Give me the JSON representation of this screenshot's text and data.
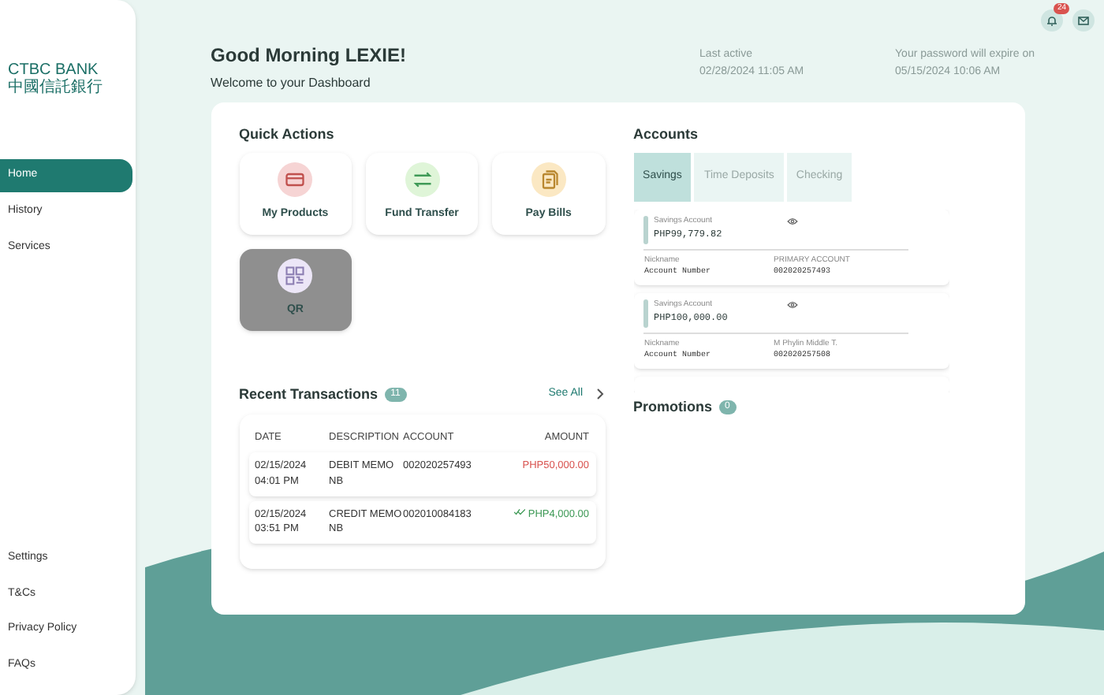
{
  "header": {
    "greeting": "Good Morning LEXIE!",
    "subtitle": "Welcome to your Dashboard",
    "last_active_label": "Last active",
    "last_active": "02/28/2024 11:05 AM",
    "password_label": "Your password will expire on",
    "password_expiry": "05/15/2024 10:06 AM",
    "notification_count": "24"
  },
  "logo": {
    "name": "CTBC BANK",
    "subname": "中國信託銀行"
  },
  "sidebar": {
    "items": [
      {
        "label": "Home",
        "selected": true
      },
      {
        "label": "History",
        "selected": false
      },
      {
        "label": "Services",
        "selected": false
      }
    ],
    "footer_items": [
      {
        "label": "Settings"
      },
      {
        "label": "T&Cs"
      },
      {
        "label": "Privacy Policy"
      },
      {
        "label": "FAQs"
      }
    ]
  },
  "quick_actions": {
    "title": "Quick Actions",
    "items": [
      {
        "label": "My Products",
        "kind": "card",
        "color": "#f6d4d4",
        "selected": false
      },
      {
        "label": "Fund Transfer",
        "kind": "transfer",
        "color": "#dff5d8",
        "selected": false
      },
      {
        "label": "Pay Bills",
        "kind": "bills",
        "color": "#fbe8c3",
        "selected": false
      },
      {
        "label": "QR",
        "kind": "qr",
        "color": "#ece6f7",
        "selected": true
      }
    ]
  },
  "accounts": {
    "title": "Accounts",
    "tabs": [
      {
        "label": "Savings",
        "selected": true
      },
      {
        "label": "Time Deposits",
        "selected": false
      },
      {
        "label": "Checking",
        "selected": false
      }
    ],
    "items": [
      {
        "type": "Savings Account",
        "balance": "PHP99,779.82",
        "nickname_label": "Nickname",
        "nickname": "PRIMARY ACCOUNT",
        "number_label": "Account Number",
        "number": "002020257493"
      },
      {
        "type": "Savings Account",
        "balance": "PHP100,000.00",
        "nickname_label": "Nickname",
        "nickname": "M Phylin Middle T.",
        "number_label": "Account Number",
        "number": "002020257508"
      }
    ]
  },
  "recent_transactions": {
    "title": "Recent Transactions",
    "count": "11",
    "see_all": "See All",
    "columns": [
      "DATE",
      "DESCRIPTION",
      "ACCOUNT",
      "AMOUNT"
    ],
    "rows": [
      {
        "date": "02/15/2024",
        "time": "04:01 PM",
        "description": "DEBIT MEMO",
        "description_2": "NB",
        "account": "002020257493",
        "amount": "PHP50,000.00",
        "kind": "debit"
      },
      {
        "date": "02/15/2024",
        "time": "03:51 PM",
        "description": "CREDIT MEMO",
        "description_2": "NB",
        "account": "002010084183",
        "amount": "PHP4,000.00",
        "kind": "credit"
      }
    ]
  },
  "promotions": {
    "title": "Promotions",
    "count": "0"
  }
}
